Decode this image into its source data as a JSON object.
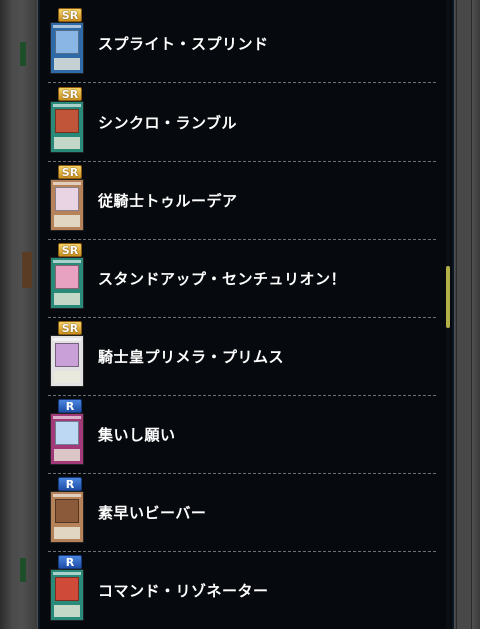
{
  "card_list": {
    "items": [
      {
        "rarity": "SR",
        "name": "スプライト・スプリンド",
        "card_color": "#2e6aa8",
        "art_color": "#8ab6e6"
      },
      {
        "rarity": "SR",
        "name": "シンクロ・ランブル",
        "card_color": "#2a8a7a",
        "art_color": "#c0553a"
      },
      {
        "rarity": "SR",
        "name": "従騎士トゥルーデア",
        "card_color": "#b5825a",
        "art_color": "#e9d4e4"
      },
      {
        "rarity": "SR",
        "name": "スタンドアップ・センチュリオン！",
        "card_color": "#2a8a7a",
        "art_color": "#e6a2c0"
      },
      {
        "rarity": "SR",
        "name": "騎士皇プリメラ・プリムス",
        "card_color": "#e2e2e2",
        "art_color": "#c9a0d8"
      },
      {
        "rarity": "R",
        "name": "集いし願い",
        "card_color": "#a23a7a",
        "art_color": "#bcd8f2"
      },
      {
        "rarity": "R",
        "name": "素早いビーバー",
        "card_color": "#b5825a",
        "art_color": "#8a5a3a"
      },
      {
        "rarity": "R",
        "name": "コマンド・リゾネーター",
        "card_color": "#2a8a7a",
        "art_color": "#d04a3a"
      }
    ]
  },
  "colors": {
    "dialog_bg": "#06090d",
    "divider": "#6b6f73",
    "sr_badge": "#e0ad3a",
    "r_badge": "#2f6ac8",
    "scroll_thumb": "#b3b04a"
  },
  "icons": {
    "rarity_badge": "rarity-badge-icon",
    "card_thumbnail": "card-thumbnail-icon"
  },
  "scroll": {
    "position_fraction": 0.47
  }
}
